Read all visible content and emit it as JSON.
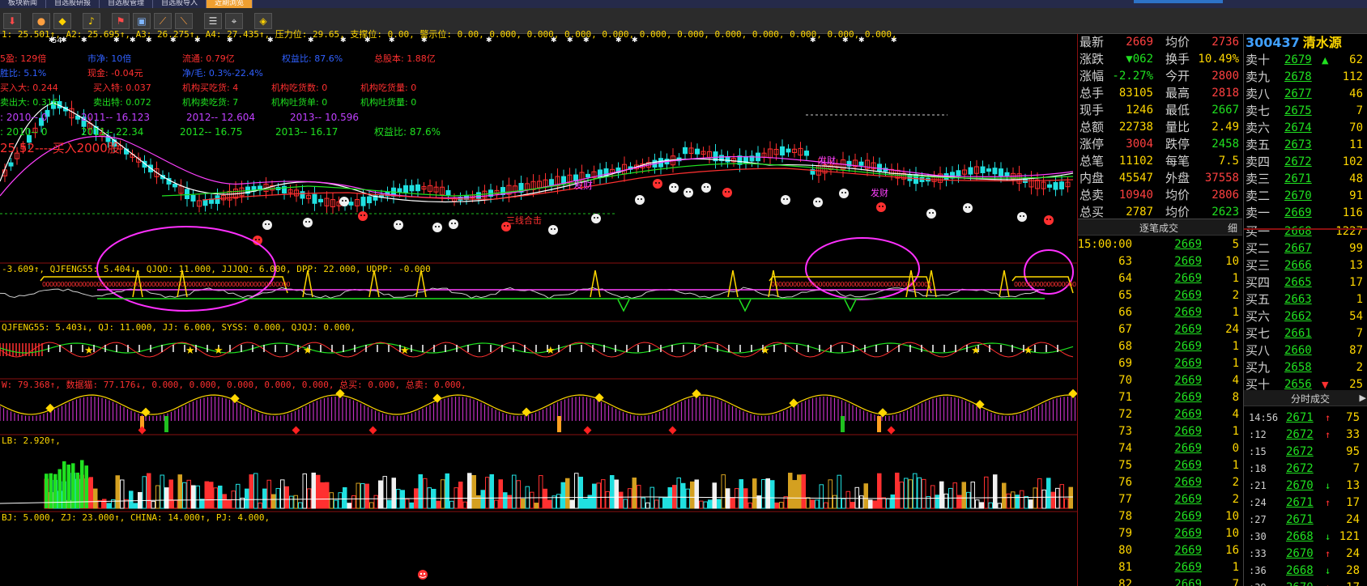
{
  "top_tabs": {
    "items": [
      "板块新闻",
      "自选股研报",
      "自选股管理",
      "自选股导入",
      "近期浏览"
    ],
    "active": 4
  },
  "toolbar": {
    "buttons": [
      "red-arrow-icon",
      "traffic-light-icon",
      "warning-icon",
      "bell-icon",
      "flag-icon",
      "picture-icon",
      "line-tool-icon",
      "line-tool-2-icon",
      "list-icon",
      "pin-icon",
      "diamond-icon"
    ]
  },
  "price_panel": {
    "ma_line": "1: 25.501↑, A2: 25.695↑, A3: 26.275↑, A4: 27.435↑, 压力位: 29.65, 支撑位: 0.00, 警示位: 0.00, 0.000, 0.000, 0.000, 0.000, 0.000, 0.000, 0.000, 0.000, 0.000, 0.000, 0.000,",
    "price_peak_label": "54",
    "info": {
      "row1": {
        "a": "5盈: 129倍",
        "b": "市净: 10倍",
        "c": "流通: 0.79亿",
        "d": "权益比: 87.6%",
        "e": "总股本: 1.88亿"
      },
      "row2": {
        "a": "胜比: 5.1%",
        "b": "现金: -0.04元",
        "c": "净/毛: 0.3%-22.4%"
      },
      "row3": {
        "a": "买入大: 0.244",
        "b": "买入特: 0.037",
        "c": "机构买吃货: 4",
        "d": "机构吃货数: 0",
        "e": "机构吃货量: 0"
      },
      "row4": {
        "a": "卖出大: 0.316",
        "b": "卖出特: 0.072",
        "c": "机构卖吃货: 7",
        "d": "机构吐货单: 0",
        "e": "机构吐货量: 0"
      },
      "row5": {
        "a": ": 2010-- 0",
        "b": "2011-- 16.123",
        "c": "2012-- 12.604",
        "d": "2013-- 10.596"
      },
      "row6": {
        "a": ": 2010-- 0",
        "b": "2011-- 22.34",
        "c": "2012-- 16.75",
        "d": "2013-- 16.17",
        "e": "权益比: 87.6%"
      },
      "buy_point": "25.52----买入2000股"
    },
    "labels": [
      "发财",
      "三线合击",
      "发财",
      "发财"
    ]
  },
  "ind1": {
    "line": "-3.609↑, QJFENG55: 5.404↓, QJQO: 11.000, JJJQQ: 6.000, DPP: 22.000, UDPP: -0.000"
  },
  "ind2": {
    "line": "QJFENG55: 5.403↓, QJ: 11.000, JJ: 6.000, SYSS: 0.000, QJQJ: 0.000,"
  },
  "ind3": {
    "line": "W: 79.368↑, 数据猫: 77.176↓, 0.000, 0.000, 0.000, 0.000, 0.000, 总买: 0.000, 总卖: 0.000,"
  },
  "ind4": {
    "line": "LB: 2.920↑,"
  },
  "ind5": {
    "line": "BJ: 5.000, ZJ: 23.000↑, CHINA: 14.000↑, PJ: 4.000,"
  },
  "quote": {
    "rows": [
      {
        "l1": "最新",
        "v1": "2669",
        "l2": "均价",
        "v2": "2736"
      },
      {
        "l1": "涨跌",
        "v1": "▼062",
        "l2": "换手",
        "v2": "10.49%"
      },
      {
        "l1": "涨幅",
        "v1": "-2.27%",
        "l2": "今开",
        "v2": "2800"
      },
      {
        "l1": "总手",
        "v1": "83105",
        "l2": "最高",
        "v2": "2818"
      },
      {
        "l1": "现手",
        "v1": "1246",
        "l2": "最低",
        "v2": "2667"
      },
      {
        "l1": "总额",
        "v1": "22738",
        "l2": "量比",
        "v2": "2.49"
      },
      {
        "l1": "涨停",
        "v1": "3004",
        "l2": "跌停",
        "v2": "2458"
      },
      {
        "l1": "总笔",
        "v1": "11102",
        "l2": "每笔",
        "v2": "7.5"
      },
      {
        "l1": "内盘",
        "v1": "45547",
        "l2": "外盘",
        "v2": "37558"
      },
      {
        "l1": "总卖",
        "v1": "10940",
        "l2": "均价",
        "v2": "2806"
      },
      {
        "l1": "总买",
        "v1": "2787",
        "l2": "均价",
        "v2": "2623"
      }
    ]
  },
  "ticks": {
    "header": "逐笔成交",
    "detail": "细",
    "rows": [
      {
        "t": "15:00:00",
        "p": "2669",
        "v": "5"
      },
      {
        "t": "63",
        "p": "2669",
        "v": "10"
      },
      {
        "t": "64",
        "p": "2669",
        "v": "1"
      },
      {
        "t": "65",
        "p": "2669",
        "v": "2"
      },
      {
        "t": "66",
        "p": "2669",
        "v": "1"
      },
      {
        "t": "67",
        "p": "2669",
        "v": "24"
      },
      {
        "t": "68",
        "p": "2669",
        "v": "1"
      },
      {
        "t": "69",
        "p": "2669",
        "v": "1"
      },
      {
        "t": "70",
        "p": "2669",
        "v": "4"
      },
      {
        "t": "71",
        "p": "2669",
        "v": "8"
      },
      {
        "t": "72",
        "p": "2669",
        "v": "4"
      },
      {
        "t": "73",
        "p": "2669",
        "v": "1"
      },
      {
        "t": "74",
        "p": "2669",
        "v": "0"
      },
      {
        "t": "75",
        "p": "2669",
        "v": "1"
      },
      {
        "t": "76",
        "p": "2669",
        "v": "2"
      },
      {
        "t": "77",
        "p": "2669",
        "v": "2"
      },
      {
        "t": "78",
        "p": "2669",
        "v": "10"
      },
      {
        "t": "79",
        "p": "2669",
        "v": "10"
      },
      {
        "t": "80",
        "p": "2669",
        "v": "16"
      },
      {
        "t": "81",
        "p": "2669",
        "v": "1"
      },
      {
        "t": "82",
        "p": "2669",
        "v": "7"
      }
    ]
  },
  "orderbook": {
    "code": "300437",
    "name": "清水源",
    "asks": [
      {
        "l": "卖十",
        "p": "2679",
        "a": "▲",
        "v": "62"
      },
      {
        "l": "卖九",
        "p": "2678",
        "a": "",
        "v": "112"
      },
      {
        "l": "卖八",
        "p": "2677",
        "a": "",
        "v": "46"
      },
      {
        "l": "卖七",
        "p": "2675",
        "a": "",
        "v": "7"
      },
      {
        "l": "卖六",
        "p": "2674",
        "a": "",
        "v": "70"
      },
      {
        "l": "卖五",
        "p": "2673",
        "a": "",
        "v": "11"
      },
      {
        "l": "卖四",
        "p": "2672",
        "a": "",
        "v": "102"
      },
      {
        "l": "卖三",
        "p": "2671",
        "a": "",
        "v": "48"
      },
      {
        "l": "卖二",
        "p": "2670",
        "a": "",
        "v": "91"
      },
      {
        "l": "卖一",
        "p": "2669",
        "a": "",
        "v": "116"
      }
    ],
    "bids": [
      {
        "l": "买一",
        "p": "2668",
        "a": "",
        "v": "1227"
      },
      {
        "l": "买二",
        "p": "2667",
        "a": "",
        "v": "99"
      },
      {
        "l": "买三",
        "p": "2666",
        "a": "",
        "v": "13"
      },
      {
        "l": "买四",
        "p": "2665",
        "a": "",
        "v": "17"
      },
      {
        "l": "买五",
        "p": "2663",
        "a": "",
        "v": "1"
      },
      {
        "l": "买六",
        "p": "2662",
        "a": "",
        "v": "54"
      },
      {
        "l": "买七",
        "p": "2661",
        "a": "",
        "v": "7"
      },
      {
        "l": "买八",
        "p": "2660",
        "a": "",
        "v": "87"
      },
      {
        "l": "买九",
        "p": "2658",
        "a": "",
        "v": "2"
      },
      {
        "l": "买十",
        "p": "2656",
        "a": "▼",
        "v": "25"
      }
    ]
  },
  "fenshi": {
    "header": "分时成交",
    "rows": [
      {
        "t": "14:56",
        "p": "2671",
        "a": "↑",
        "v": "75",
        "c": "up"
      },
      {
        "t": ":12",
        "p": "2672",
        "a": "↑",
        "v": "33",
        "c": "up"
      },
      {
        "t": ":15",
        "p": "2672",
        "a": "",
        "v": "95",
        "c": "up"
      },
      {
        "t": ":18",
        "p": "2672",
        "a": "",
        "v": "7",
        "c": "up"
      },
      {
        "t": ":21",
        "p": "2670",
        "a": "↓",
        "v": "13",
        "c": "dn"
      },
      {
        "t": ":24",
        "p": "2671",
        "a": "↑",
        "v": "17",
        "c": "up"
      },
      {
        "t": ":27",
        "p": "2671",
        "a": "",
        "v": "24",
        "c": "up"
      },
      {
        "t": ":30",
        "p": "2668",
        "a": "↓",
        "v": "121",
        "c": "dn"
      },
      {
        "t": ":33",
        "p": "2670",
        "a": "↑",
        "v": "24",
        "c": "up"
      },
      {
        "t": ":36",
        "p": "2668",
        "a": "↓",
        "v": "28",
        "c": "dn"
      },
      {
        "t": ":39",
        "p": "2670",
        "a": "↑",
        "v": "17",
        "c": "up"
      }
    ]
  }
}
